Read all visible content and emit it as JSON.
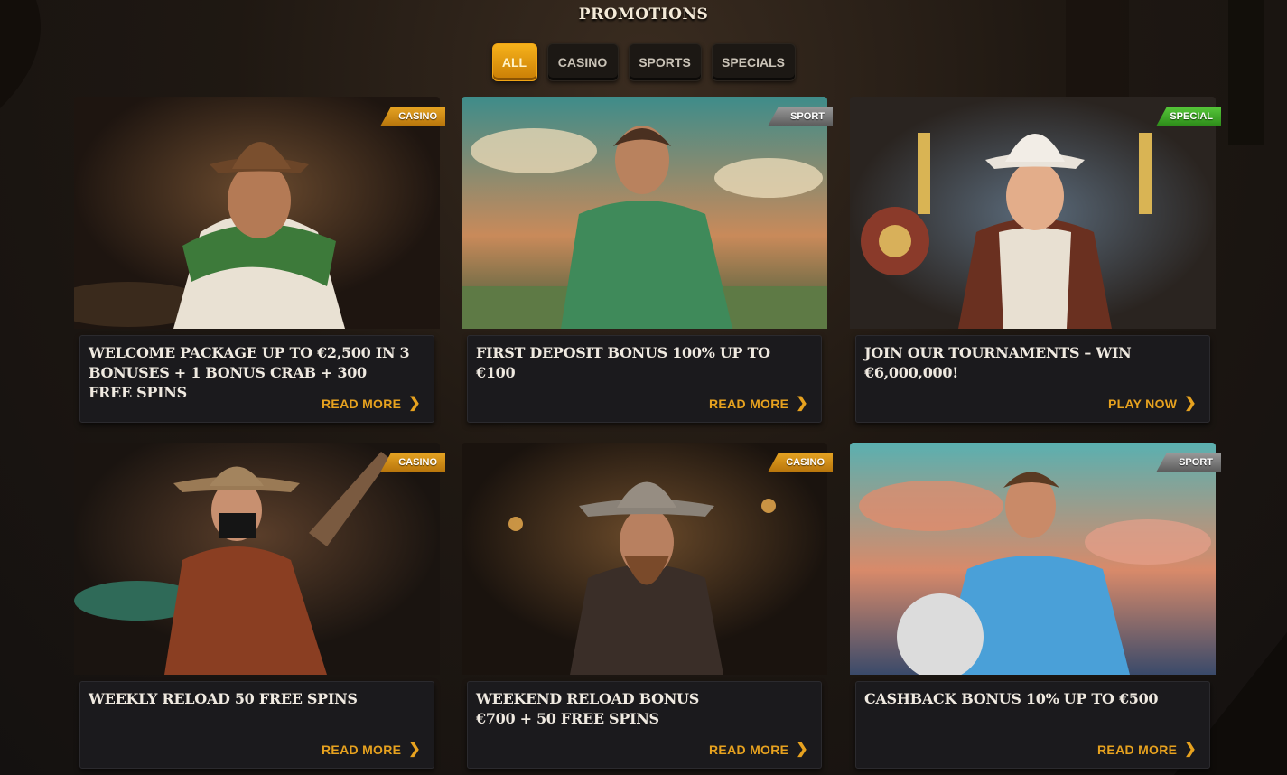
{
  "page": {
    "title": "PROMOTIONS"
  },
  "tabs": [
    {
      "label": "ALL",
      "active": true
    },
    {
      "label": "CASINO",
      "active": false
    },
    {
      "label": "SPORTS",
      "active": false
    },
    {
      "label": "SPECIALS",
      "active": false
    }
  ],
  "promotions": [
    {
      "category": "CASINO",
      "title": "WELCOME PACKAGE UP TO €2,500 IN 3 BONUSES + 1 BONUS CRAB + 300 FREE SPINS",
      "action": "READ MORE"
    },
    {
      "category": "SPORT",
      "title": "FIRST DEPOSIT BONUS 100% UP TO €100",
      "action": "READ MORE"
    },
    {
      "category": "SPECIAL",
      "title": "JOIN OUR TOURNAMENTS – WIN €6,000,000!",
      "action": "PLAY NOW"
    },
    {
      "category": "CASINO",
      "title": "WEEKLY RELOAD 50 FREE SPINS",
      "action": "READ MORE"
    },
    {
      "category": "CASINO",
      "title": "WEEKEND RELOAD BONUS €700 + 50 FREE SPINS",
      "action": "READ MORE"
    },
    {
      "category": "SPORT",
      "title": "CASHBACK BONUS 10% UP TO €500",
      "action": "READ MORE"
    }
  ],
  "icons": {
    "action_chevron": "chevron-right-icon"
  },
  "colors": {
    "accent": "#e7a21f",
    "casino": "#d9961b",
    "sport": "#808080",
    "special": "#46b52c"
  }
}
